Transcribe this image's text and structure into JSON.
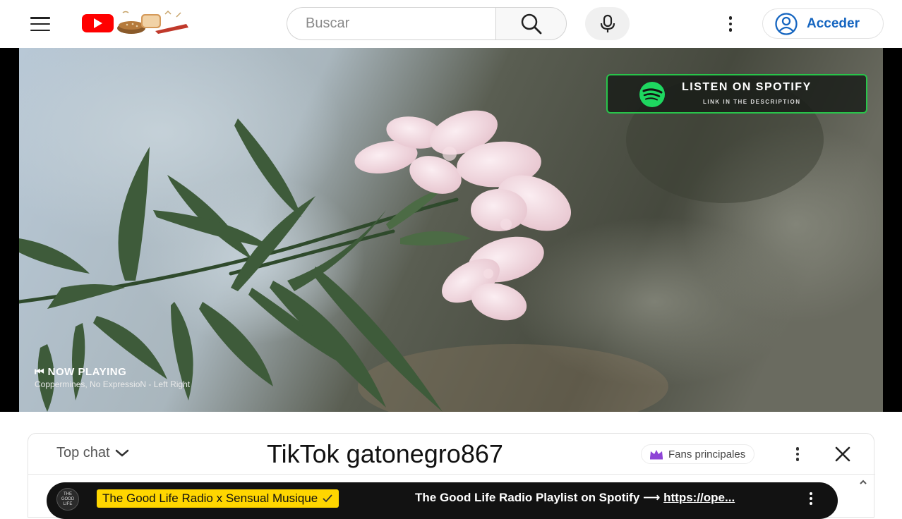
{
  "header": {
    "search_placeholder": "Buscar",
    "signin_label": "Acceder"
  },
  "player": {
    "spotify_title": "LISTEN ON SPOTIFY",
    "spotify_subtitle": "LINK IN THE DESCRIPTION",
    "now_playing_label": "⏮ NOW PLAYING",
    "now_playing_track": "Coppermines, No ExpressioN - Left Right"
  },
  "chat": {
    "mode_label": "Top chat",
    "overlay_text": "TikTok gatonegro867",
    "fans_label": "Fans principales",
    "pinned": {
      "avatar_text": "THE GOOD LIFE",
      "channel_name": "The Good Life Radio x Sensual Musique",
      "message_prefix": "The Good Life Radio Playlist on Spotify ⟶ ",
      "message_link": "https://ope..."
    }
  },
  "colors": {
    "brand_red": "#ff0000",
    "link_blue": "#1565c0",
    "spotify_green": "#1ed760",
    "chip_yellow": "#ffd600",
    "fans_purple": "#8e44d6"
  }
}
